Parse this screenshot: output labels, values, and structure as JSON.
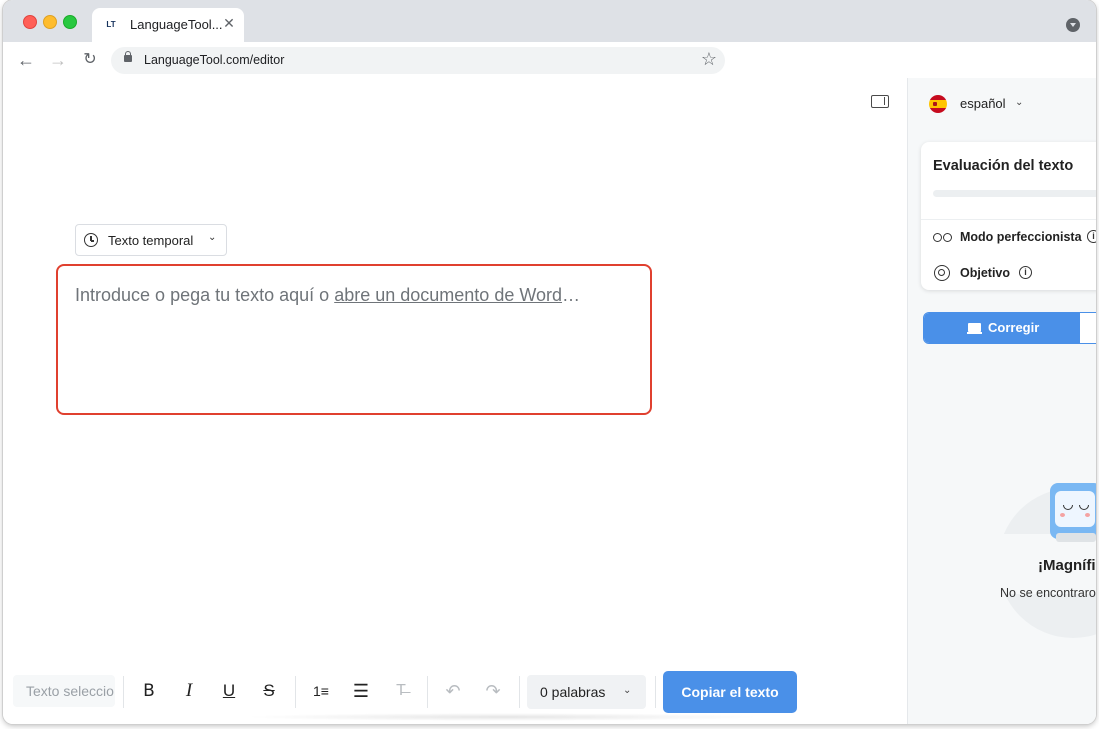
{
  "browser": {
    "tab_title": "LanguageTool...",
    "tab_favicon": "LT",
    "url": "LanguageTool.com/editor"
  },
  "icons": {
    "back": "←",
    "forward": "→",
    "reload": "↻",
    "star": "☆",
    "close": "✕",
    "chevron": "⌄",
    "info": "i"
  },
  "editor": {
    "history_label": "Texto temporal",
    "placeholder_prefix": "Introduce o pega tu texto aquí o ",
    "placeholder_link": "abre un documento de Word",
    "placeholder_suffix": "…"
  },
  "panel": {
    "language": "español",
    "evaluation_title": "Evaluación del texto",
    "perfectionist_mode": "Modo perfeccionista",
    "objective": "Objetivo",
    "correct_tab": "Corregir",
    "success_title": "¡Magnífi",
    "success_sub": "No se encontraro"
  },
  "toolbar": {
    "selected_text_placeholder": "Texto seleccio",
    "bold": "B",
    "italic": "I",
    "underline": "U",
    "strike": "S",
    "ordered_list": "1≡",
    "bullet_list": "☰",
    "clear_format": "T̶",
    "undo": "↶",
    "redo": "↷",
    "word_count": "0 palabras",
    "copy_label": "Copiar el texto"
  },
  "colors": {
    "accent": "#4a90e8",
    "editor_border": "#e0402f"
  }
}
